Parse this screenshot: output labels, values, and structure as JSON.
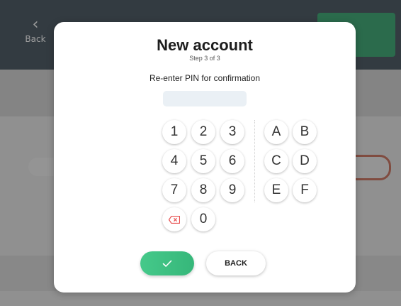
{
  "background": {
    "back_label": "Back",
    "colors": {
      "topbar": "#3d4b57",
      "accent_green": "#2ea36b",
      "highlight": "#c86a55"
    }
  },
  "modal": {
    "title": "New account",
    "step": "Step 3 of 3",
    "instruction": "Re-enter PIN for confirmation",
    "pin_value": "",
    "keypad": {
      "digits": [
        "1",
        "2",
        "3",
        "4",
        "5",
        "6",
        "7",
        "8",
        "9",
        "0"
      ],
      "letters": [
        "A",
        "B",
        "C",
        "D",
        "E",
        "F"
      ],
      "delete_icon": "backspace-icon",
      "delete_color": "#e85050"
    },
    "confirm_icon": "check-icon",
    "confirm_color": "#3cc182",
    "back_label": "BACK"
  }
}
